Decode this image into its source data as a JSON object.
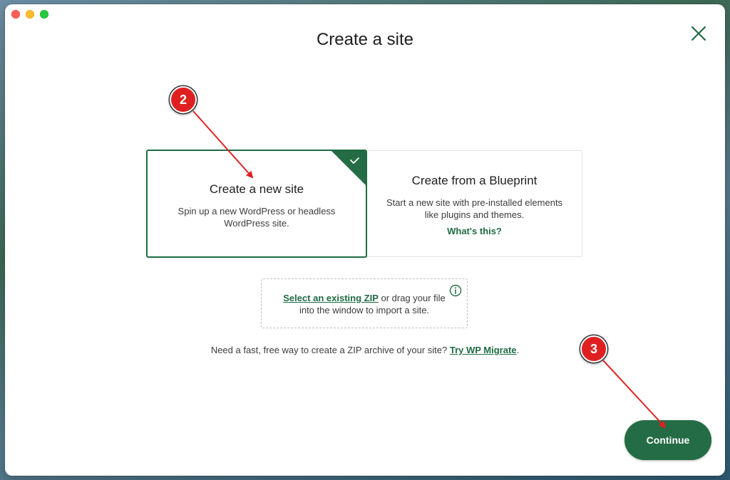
{
  "dialog": {
    "title": "Create a site",
    "close_icon": "close-icon"
  },
  "options": [
    {
      "title": "Create a new site",
      "description": "Spin up a new WordPress or headless WordPress site.",
      "selected": true
    },
    {
      "title": "Create from a Blueprint",
      "description": "Start a new site with pre-installed elements like plugins and themes.",
      "link": "What's this?",
      "selected": false
    }
  ],
  "import": {
    "link": "Select an existing ZIP",
    "text": " or drag your file into the window to import a site.",
    "info_icon": "info-icon"
  },
  "migrate": {
    "text": "Need a fast, free way to create a ZIP archive of your site? ",
    "link": "Try WP Migrate",
    "suffix": "."
  },
  "continue_label": "Continue",
  "annotations": [
    {
      "label": "2"
    },
    {
      "label": "3"
    }
  ],
  "colors": {
    "accent": "#236c45",
    "annotation": "#e02020"
  }
}
